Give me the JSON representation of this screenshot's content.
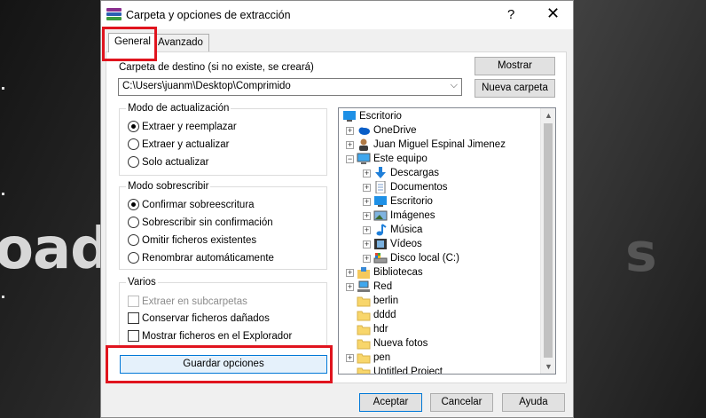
{
  "background": {
    "brand_text": "oads",
    "brand_text2": "s"
  },
  "dialog": {
    "title": "Carpeta y opciones de extracción",
    "help_label": "?",
    "close_label": "✕",
    "tabs": [
      {
        "label": "General"
      },
      {
        "label": "Avanzado"
      }
    ],
    "destination": {
      "label": "Carpeta de destino (si no existe, se creará)",
      "value": "C:\\Users\\juanm\\Desktop\\Comprimido",
      "show_button": "Mostrar",
      "new_folder_button": "Nueva carpeta"
    },
    "update_mode": {
      "title": "Modo de actualización",
      "options": [
        {
          "label": "Extraer y reemplazar",
          "checked": true
        },
        {
          "label": "Extraer y actualizar",
          "checked": false
        },
        {
          "label": "Solo actualizar",
          "checked": false
        }
      ]
    },
    "overwrite_mode": {
      "title": "Modo sobrescribir",
      "options": [
        {
          "label": "Confirmar sobreescritura",
          "checked": true
        },
        {
          "label": "Sobrescribir sin confirmación",
          "checked": false
        },
        {
          "label": "Omitir ficheros existentes",
          "checked": false
        },
        {
          "label": "Renombrar automáticamente",
          "checked": false
        }
      ]
    },
    "misc": {
      "title": "Varios",
      "options": [
        {
          "label": "Extraer en subcarpetas",
          "checked": false,
          "disabled": true
        },
        {
          "label": "Conservar ficheros dañados",
          "checked": false,
          "disabled": false
        },
        {
          "label": "Mostrar ficheros en el Explorador",
          "checked": false,
          "disabled": false
        }
      ]
    },
    "save_button": "Guardar opciones",
    "tree": [
      {
        "label": "Escritorio",
        "icon": "desktop-icon"
      },
      {
        "label": "OneDrive",
        "icon": "cloud-icon"
      },
      {
        "label": "Juan Miguel Espinal Jimenez",
        "icon": "user-icon"
      },
      {
        "label": "Este equipo",
        "icon": "computer-icon"
      },
      {
        "label": "Descargas",
        "icon": "download-icon"
      },
      {
        "label": "Documentos",
        "icon": "document-icon"
      },
      {
        "label": "Escritorio",
        "icon": "desktop-icon"
      },
      {
        "label": "Imágenes",
        "icon": "image-icon"
      },
      {
        "label": "Música",
        "icon": "music-icon"
      },
      {
        "label": "Vídeos",
        "icon": "video-icon"
      },
      {
        "label": "Disco local (C:)",
        "icon": "drive-icon"
      },
      {
        "label": "Bibliotecas",
        "icon": "library-icon"
      },
      {
        "label": "Red",
        "icon": "network-icon"
      },
      {
        "label": "berlin",
        "icon": "folder-icon"
      },
      {
        "label": "dddd",
        "icon": "folder-icon"
      },
      {
        "label": "hdr",
        "icon": "folder-icon"
      },
      {
        "label": "Nueva fotos",
        "icon": "folder-icon"
      },
      {
        "label": "pen",
        "icon": "folder-icon"
      },
      {
        "label": "Untitled Project",
        "icon": "folder-icon"
      }
    ],
    "footer": {
      "accept": "Aceptar",
      "cancel": "Cancelar",
      "help": "Ayuda"
    },
    "highlight_color": "#e0141e"
  }
}
